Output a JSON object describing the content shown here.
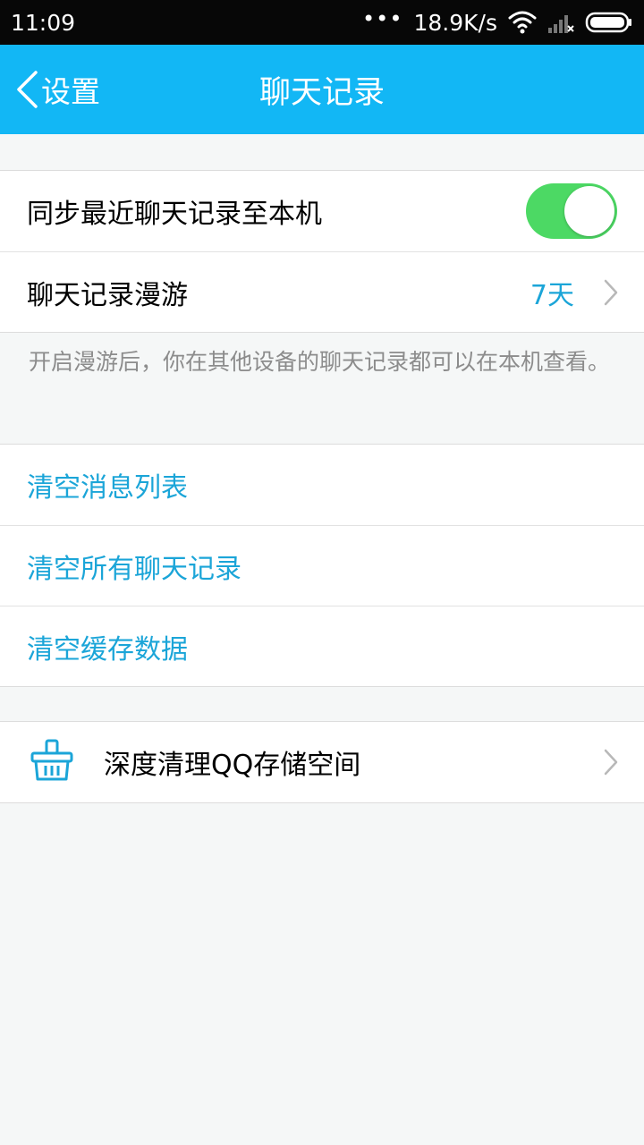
{
  "status_bar": {
    "time": "11:09",
    "dots": "•••",
    "speed": "18.9K/s",
    "icons": [
      "wifi-icon",
      "signal-icon",
      "battery-icon"
    ]
  },
  "header": {
    "back_label": "设置",
    "title": "聊天记录"
  },
  "sync": {
    "label": "同步最近聊天记录至本机",
    "enabled": true
  },
  "roaming": {
    "label": "聊天记录漫游",
    "value": "7天"
  },
  "hint": "开启漫游后，你在其他设备的聊天记录都可以在本机查看。",
  "clear_actions": [
    {
      "label": "清空消息列表"
    },
    {
      "label": "清空所有聊天记录"
    },
    {
      "label": "清空缓存数据"
    }
  ],
  "deep_clean": {
    "label": "深度清理QQ存储空间"
  },
  "colors": {
    "header": "#12b7f5",
    "link": "#1ba5d8",
    "toggle_on": "#4cd964",
    "background": "#f5f7f7"
  }
}
